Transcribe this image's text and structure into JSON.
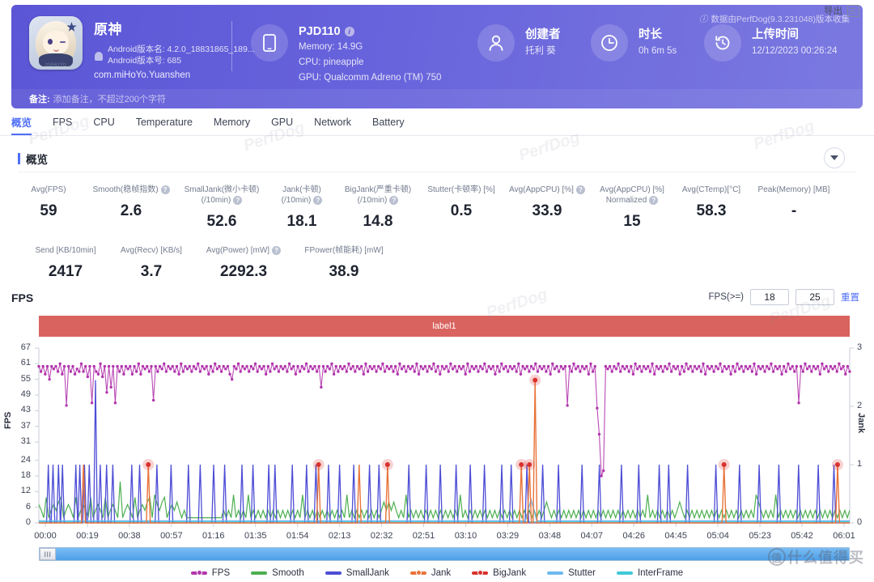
{
  "header": {
    "app_name": "原神",
    "android_version_name": "Android版本名: 4.2.0_18831865_189...",
    "android_version_code": "Android版本号: 685",
    "package": "com.miHoYo.Yuanshen",
    "icon_brand": "miHoYo",
    "device": {
      "name": "PJD110",
      "memory": "Memory: 14.9G",
      "cpu": "CPU: pineapple",
      "gpu": "GPU: Qualcomm Adreno (TM) 750"
    },
    "creator": {
      "title": "创建者",
      "value": "托利 葵"
    },
    "duration": {
      "title": "时长",
      "value": "0h 6m 5s"
    },
    "upload": {
      "title": "上传时间",
      "value": "12/12/2023 00:26:24"
    },
    "version_note": "数据由PerfDog(9.3.231048)版本收集",
    "note_label": "备注:",
    "note_placeholder": "添加备注，不超过200个字符"
  },
  "tabs": [
    {
      "label": "概览",
      "active": true
    },
    {
      "label": "FPS",
      "active": false
    },
    {
      "label": "CPU",
      "active": false
    },
    {
      "label": "Temperature",
      "active": false
    },
    {
      "label": "Memory",
      "active": false
    },
    {
      "label": "GPU",
      "active": false
    },
    {
      "label": "Network",
      "active": false
    },
    {
      "label": "Battery",
      "active": false
    }
  ],
  "export_label": "导出",
  "overview": {
    "title": "概览",
    "row1": [
      {
        "label": "Avg(FPS)",
        "help": false,
        "value": "59"
      },
      {
        "label": "Smooth(稳帧指数)",
        "help": true,
        "value": "2.6"
      },
      {
        "label": "SmallJank(微小卡顿)\n(/10min)",
        "help": true,
        "value": "52.6"
      },
      {
        "label": "Jank(卡顿)\n(/10min)",
        "help": true,
        "value": "18.1"
      },
      {
        "label": "BigJank(严重卡顿)\n(/10min)",
        "help": true,
        "value": "14.8"
      },
      {
        "label": "Stutter(卡顿率) [%]",
        "help": false,
        "value": "0.5"
      },
      {
        "label": "Avg(AppCPU) [%]",
        "help": true,
        "value": "33.9"
      },
      {
        "label": "Avg(AppCPU) [%]\nNormalized",
        "help": true,
        "value": "15"
      },
      {
        "label": "Avg(CTemp)[°C]",
        "help": false,
        "value": "58.3"
      },
      {
        "label": "Peak(Memory) [MB]",
        "help": false,
        "value": "-"
      }
    ],
    "row2": [
      {
        "label": "Send [KB/10min]",
        "help": false,
        "value": "2417"
      },
      {
        "label": "Avg(Recv) [KB/s]",
        "help": false,
        "value": "3.7"
      },
      {
        "label": "Avg(Power) [mW]",
        "help": true,
        "value": "2292.3"
      },
      {
        "label": "FPower(帧能耗) [mW]",
        "help": false,
        "value": "38.9"
      }
    ]
  },
  "fps_section": {
    "title": "FPS",
    "threshold_label": "FPS(>=)",
    "threshold_low": "18",
    "threshold_high": "25",
    "reset_label": "重置",
    "label_bar": "label1",
    "scroll_handle": "III"
  },
  "chart_data": {
    "type": "line",
    "title": "FPS",
    "xlabel": "",
    "ylabel": "FPS",
    "y2label": "Jank",
    "ylim": [
      0,
      67
    ],
    "y2lim": [
      0,
      3
    ],
    "yticks": [
      0,
      6,
      12,
      18,
      24,
      31,
      37,
      43,
      49,
      55,
      61,
      67
    ],
    "y2ticks": [
      0,
      1,
      2,
      3
    ],
    "xticks": [
      "00:00",
      "00:19",
      "00:38",
      "00:57",
      "01:16",
      "01:35",
      "01:54",
      "02:13",
      "02:32",
      "02:51",
      "03:10",
      "03:29",
      "03:48",
      "04:07",
      "04:26",
      "04:45",
      "05:04",
      "05:23",
      "05:42",
      "06:01"
    ],
    "grid": false,
    "legend_position": "bottom",
    "annotations": [
      {
        "label": "label1",
        "type": "span-bar",
        "color": "#d9645f"
      }
    ],
    "series": [
      {
        "name": "FPS",
        "color": "#b235ad",
        "axis": "left",
        "marker": "dot",
        "values": [
          60,
          58,
          60,
          57,
          60,
          55,
          60,
          59,
          60,
          58,
          61,
          57,
          60,
          45,
          60,
          58,
          60,
          57,
          59,
          58,
          61,
          58,
          60,
          56,
          60,
          46,
          60,
          58,
          57,
          61,
          56,
          60,
          50,
          60,
          52,
          60,
          46,
          60,
          58,
          60,
          57,
          60,
          59,
          60,
          57,
          60,
          58,
          61,
          57,
          60,
          59,
          60,
          58,
          60,
          47,
          60,
          58,
          60,
          59,
          61,
          58,
          60,
          59,
          60,
          58,
          60,
          57,
          61,
          58,
          60,
          59,
          60,
          58,
          60,
          59,
          61,
          58,
          60,
          59,
          60,
          57,
          60,
          58,
          61,
          59,
          60,
          58,
          60,
          59,
          60,
          57,
          55,
          60,
          59,
          61,
          58,
          60,
          59,
          60,
          58,
          60,
          59,
          61,
          58,
          60,
          59,
          60,
          57,
          60,
          58,
          61,
          59,
          60,
          58,
          60,
          59,
          60,
          58,
          61,
          59,
          60,
          57,
          60,
          58,
          60,
          59,
          61,
          58,
          60,
          59,
          60,
          58,
          60,
          52,
          60,
          58,
          60,
          59,
          61,
          57,
          60,
          58,
          60,
          59,
          60,
          58,
          61,
          59,
          60,
          58,
          60,
          59,
          60,
          57,
          61,
          58,
          60,
          59,
          60,
          58,
          60,
          59,
          61,
          58,
          60,
          59,
          60,
          58,
          60,
          57,
          61,
          59,
          60,
          58,
          60,
          59,
          60,
          58,
          61,
          57,
          60,
          59,
          60,
          58,
          60,
          59,
          61,
          58,
          60,
          57,
          60,
          59,
          60,
          58,
          61,
          59,
          60,
          58,
          60,
          59,
          60,
          57,
          61,
          58,
          60,
          59,
          60,
          58,
          60,
          59,
          61,
          58,
          60,
          59,
          60,
          57,
          60,
          58,
          61,
          59,
          60,
          58,
          60,
          59,
          60,
          58,
          61,
          57,
          60,
          59,
          60,
          58,
          60,
          59,
          61,
          58,
          60,
          59,
          60,
          58,
          60,
          57,
          61,
          59,
          60,
          58,
          60,
          59,
          60,
          45,
          60,
          58,
          61,
          59,
          60,
          58,
          60,
          59,
          60,
          57,
          61,
          58,
          60,
          44,
          34,
          18,
          20,
          60,
          59,
          60,
          58,
          60,
          59,
          61,
          58,
          60,
          59,
          60,
          58,
          60,
          57,
          61,
          59,
          60,
          58,
          60,
          59,
          60,
          58,
          61,
          57,
          60,
          59,
          60,
          58,
          60,
          59,
          61,
          58,
          60,
          59,
          60,
          57,
          60,
          58,
          61,
          59,
          60,
          58,
          60,
          59,
          60,
          58,
          61,
          57,
          60,
          59,
          60,
          58,
          60,
          59,
          61,
          58,
          60,
          59,
          60,
          57,
          60,
          58,
          61,
          59,
          60,
          58,
          60,
          59,
          60,
          58,
          61,
          57,
          60,
          59,
          60,
          58,
          60,
          59,
          61,
          58,
          60,
          59,
          60,
          57,
          60,
          58,
          61,
          59,
          60,
          58,
          60,
          46,
          60,
          58,
          61,
          59,
          60,
          58,
          60,
          59,
          60,
          57,
          61,
          59,
          60,
          58,
          60,
          59,
          60,
          58,
          61,
          59,
          60,
          57,
          60,
          58
        ]
      },
      {
        "name": "Smooth",
        "color": "#4caf50",
        "axis": "left",
        "marker": "line",
        "description": "low baseline around 0-12 with small ripples"
      },
      {
        "name": "SmallJank",
        "color": "#4d4dd6",
        "axis": "right",
        "marker": "line",
        "description": "frequent spikes to 1 jank"
      },
      {
        "name": "Jank",
        "color": "#e8743b",
        "axis": "right",
        "marker": "dot",
        "description": "occasional spikes to 1, one to 2"
      },
      {
        "name": "BigJank",
        "color": "#d9322e",
        "axis": "right",
        "marker": "dot",
        "description": "highlighted circle markers at ~00:38, 01:54, 02:13, 03:27, 03:31, 03:33, 05:04, 06:01"
      },
      {
        "name": "Stutter",
        "color": "#6db9f0",
        "axis": "left",
        "marker": "line",
        "description": "near zero with a spike near 03:33"
      },
      {
        "name": "InterFrame",
        "color": "#3fc8d8",
        "axis": "left",
        "marker": "line",
        "description": "near zero flat"
      }
    ]
  },
  "legend": [
    {
      "label": "FPS",
      "color": "#b235ad",
      "dot": true
    },
    {
      "label": "Smooth",
      "color": "#4caf50",
      "dot": false
    },
    {
      "label": "SmallJank",
      "color": "#4d4dd6",
      "dot": false
    },
    {
      "label": "Jank",
      "color": "#e8743b",
      "dot": true
    },
    {
      "label": "BigJank",
      "color": "#d9322e",
      "dot": true
    },
    {
      "label": "Stutter",
      "color": "#6db9f0",
      "dot": false
    },
    {
      "label": "InterFrame",
      "color": "#3fc8d8",
      "dot": false
    }
  ],
  "watermarks": [
    "PerfDog",
    "PerfDog",
    "PerfDog",
    "PerfDog",
    "PerfDog",
    "PerfDog"
  ],
  "corner_watermark": "值 什么值得买"
}
